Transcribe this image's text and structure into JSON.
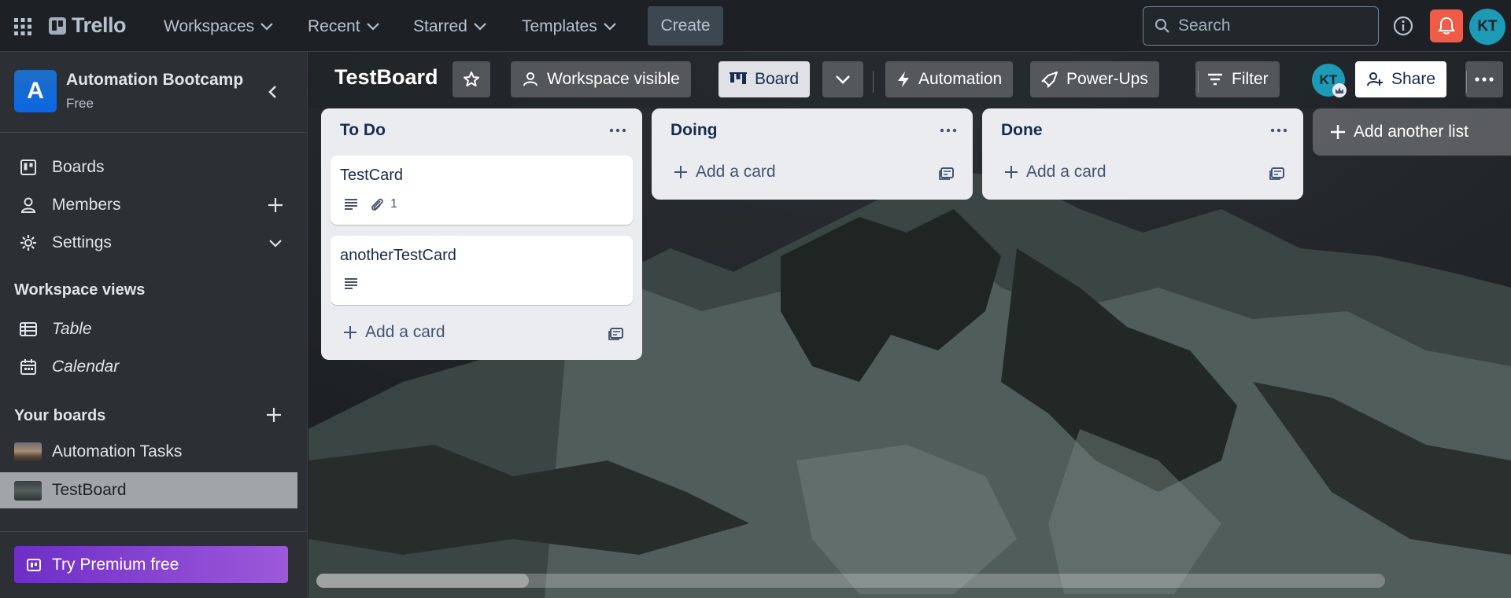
{
  "topbar": {
    "logo_text": "Trello",
    "nav": [
      "Workspaces",
      "Recent",
      "Starred",
      "Templates"
    ],
    "create_label": "Create",
    "search_placeholder": "Search",
    "avatar_initials": "KT",
    "colors": {
      "bell": "#ef5c48",
      "avatar": "#1d9ab6"
    }
  },
  "sidebar": {
    "workspace_initial": "A",
    "workspace_name": "Automation Bootcamp",
    "workspace_plan": "Free",
    "items": [
      {
        "label": "Boards",
        "icon": "board-icon"
      },
      {
        "label": "Members",
        "icon": "person-icon"
      },
      {
        "label": "Settings",
        "icon": "gear-icon"
      }
    ],
    "views_title": "Workspace views",
    "views": [
      {
        "label": "Table",
        "icon": "table-icon"
      },
      {
        "label": "Calendar",
        "icon": "calendar-icon"
      }
    ],
    "boards_title": "Your boards",
    "boards": [
      {
        "label": "Automation Tasks",
        "selected": false
      },
      {
        "label": "TestBoard",
        "selected": true
      }
    ],
    "premium_label": "Try Premium free"
  },
  "board": {
    "title": "TestBoard",
    "visibility_label": "Workspace visible",
    "view_label": "Board",
    "automation_label": "Automation",
    "powerups_label": "Power-Ups",
    "filter_label": "Filter",
    "member_initials": "KT",
    "share_label": "Share",
    "add_list_label": "Add another list",
    "lists": [
      {
        "title": "To Do",
        "cards": [
          {
            "title": "TestCard",
            "has_description": true,
            "attachments": "1"
          },
          {
            "title": "anotherTestCard",
            "has_description": true
          }
        ],
        "add_label": "Add a card"
      },
      {
        "title": "Doing",
        "cards": [],
        "add_label": "Add a card"
      },
      {
        "title": "Done",
        "cards": [],
        "add_label": "Add a card"
      }
    ]
  }
}
